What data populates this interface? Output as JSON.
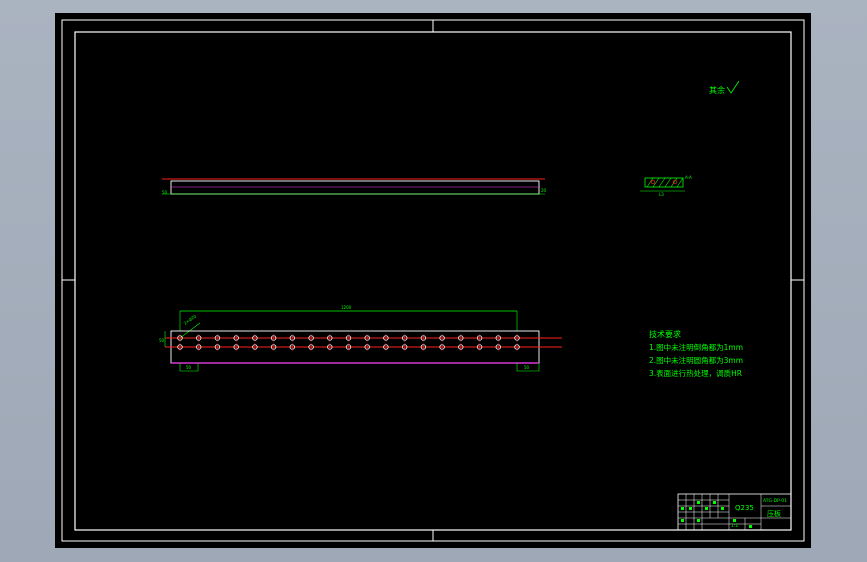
{
  "drawing": {
    "roughness_note": "其余",
    "side_view": {
      "label_left": "50",
      "label_right": "20"
    },
    "section_view": {
      "top_label": "A-A",
      "bottom_label": "L3"
    },
    "front_view": {
      "overall_dim": "1200",
      "hole_note": "2×Ø20",
      "height_dim": "50",
      "left_dim": "50",
      "right_dim": "50",
      "hole_count": 19
    },
    "notes": {
      "title": "技术要求",
      "items": [
        "1.图中未注明倒角都为1mm",
        "2.图中未注明圆角都为3mm",
        "3.表面进行热处理，调质HR"
      ]
    },
    "title_block": {
      "material": "Q235",
      "drawing_no": "ATG-DP-01",
      "part_name": "压板",
      "scale": "1:1"
    }
  },
  "colors": {
    "frame": "#ffffff",
    "geometry": "#ffffff",
    "dimension": "#00ff00",
    "centerline": "#ff2020",
    "hidden": "#ff40ff"
  }
}
